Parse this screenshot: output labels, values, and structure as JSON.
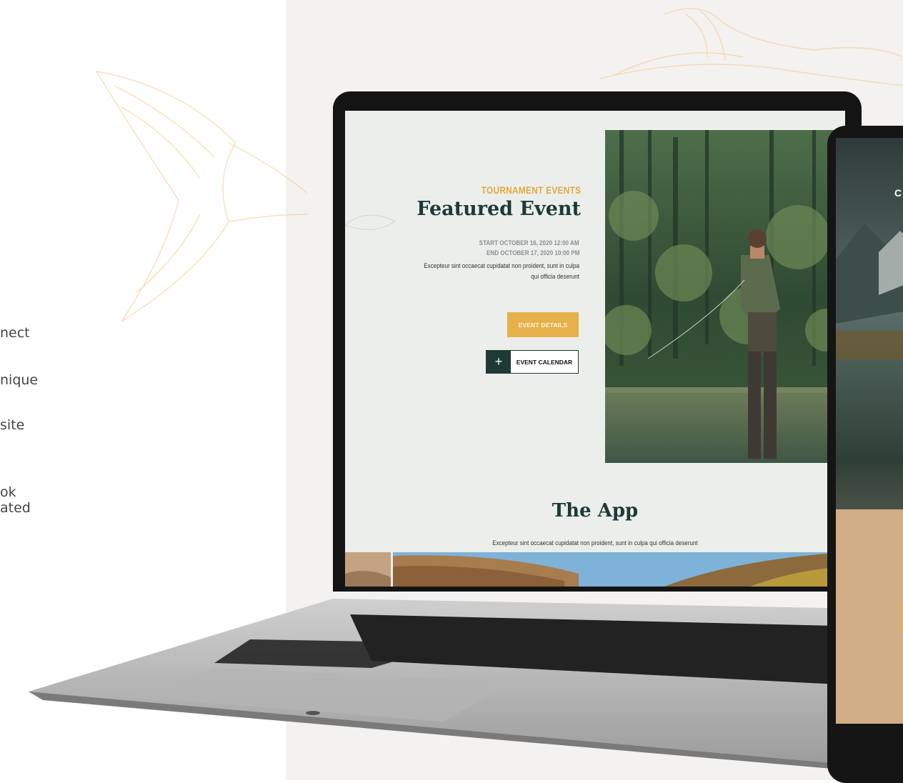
{
  "side_text": {
    "lines": [
      "nect",
      "nique",
      "site",
      "ok",
      "ated"
    ]
  },
  "featured": {
    "eyebrow": "TOURNAMENT EVENTS",
    "title": "Featured Event",
    "start": "START OCTOBER 16, 2020   12:00 AM",
    "end": "END OCTOBER 17, 2020   10:00 PM",
    "description": "Excepteur sint occaecat cupidatat non proident, sunt in culpa qui officia deserunt",
    "details_button": "EVENT DETAILS",
    "calendar_button": "EVENT CALENDAR",
    "calendar_plus": "+"
  },
  "app_section": {
    "title": "The App",
    "description": "Excepteur sint occaecat cupidatat non proident, sunt in culpa qui officia deserunt"
  },
  "tablet": {
    "logo_letter": "C"
  },
  "colors": {
    "accent_gold": "#e6b04a",
    "dark_green": "#1d3a34",
    "fish_sketch": "#f2c98a"
  }
}
